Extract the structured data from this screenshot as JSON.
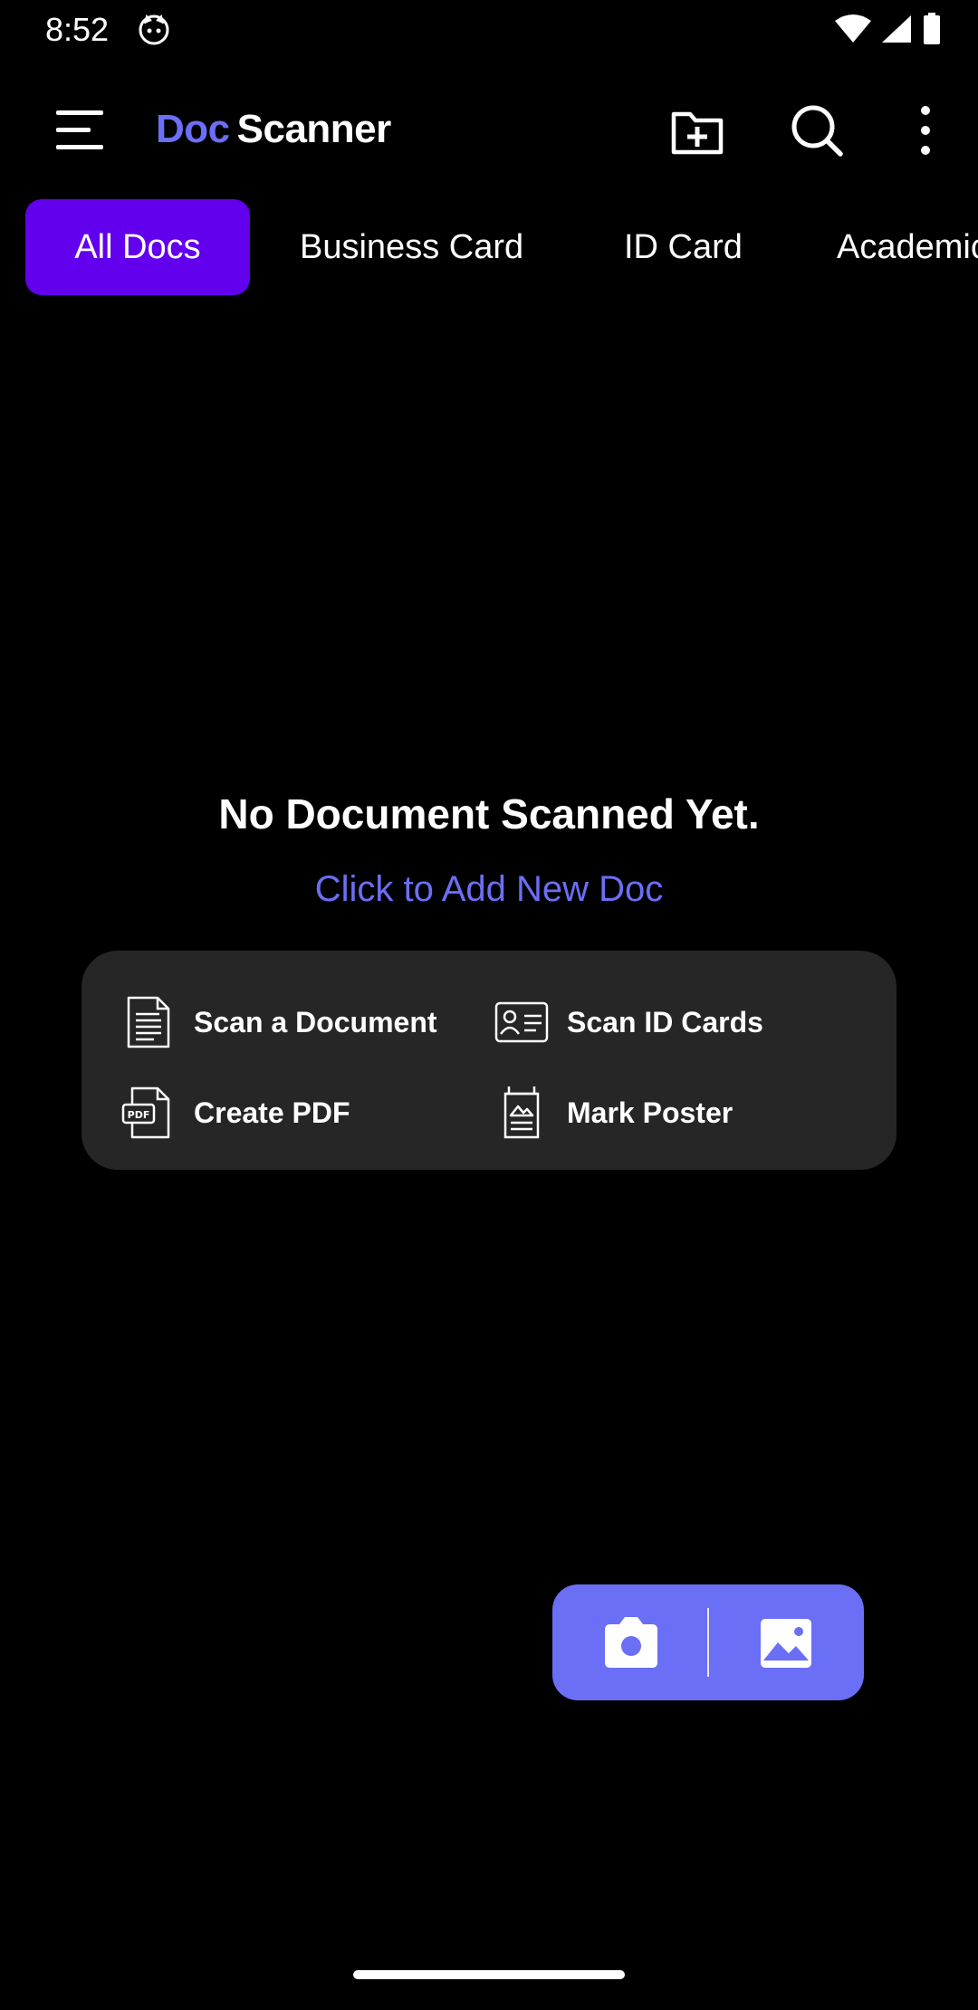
{
  "status_bar": {
    "time": "8:52"
  },
  "app_bar": {
    "title_part1": "Doc",
    "title_part2": "Scanner"
  },
  "tabs": [
    {
      "label": "All Docs",
      "active": true
    },
    {
      "label": "Business Card",
      "active": false
    },
    {
      "label": "ID Card",
      "active": false
    },
    {
      "label": "Academic",
      "active": false
    }
  ],
  "empty_state": {
    "title": "No Document Scanned Yet.",
    "link": "Click to Add New Doc"
  },
  "quick_actions": [
    {
      "label": "Scan a Document",
      "icon": "document-icon"
    },
    {
      "label": "Scan ID Cards",
      "icon": "id-card-icon"
    },
    {
      "label": "Create PDF",
      "icon": "pdf-icon"
    },
    {
      "label": "Mark Poster",
      "icon": "poster-icon"
    }
  ],
  "icons": {
    "menu": "menu-icon",
    "add_folder": "add-folder-icon",
    "search": "search-icon",
    "more": "more-vert-icon",
    "camera": "camera-icon",
    "gallery": "gallery-icon"
  },
  "colors": {
    "background": "#000000",
    "accent": "#6b6ff5",
    "active_tab": "#6200ee",
    "card": "#262626",
    "text": "#ffffff"
  }
}
